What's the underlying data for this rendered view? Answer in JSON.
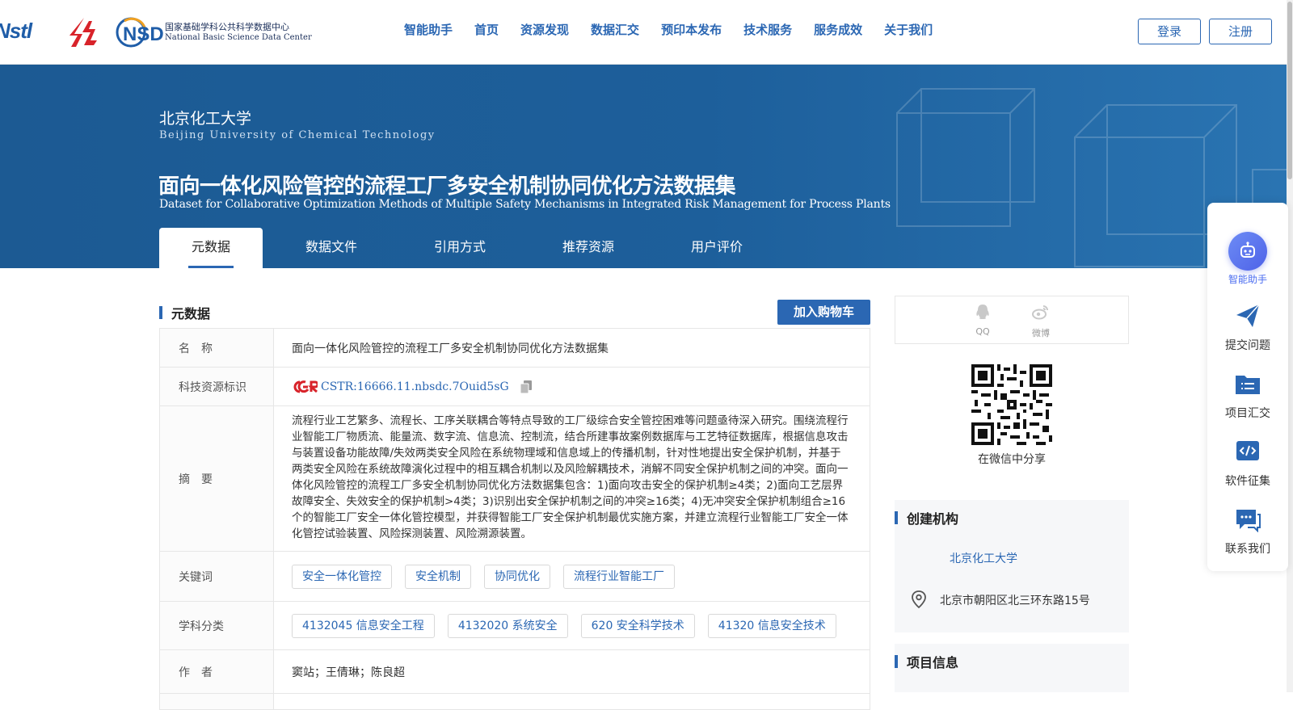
{
  "header": {
    "logo_nstl": "Nstl",
    "logo_nsdc_mark": "NSDC",
    "logo_nsdc_cn": "国家基础学科公共科学数据中心",
    "logo_nsdc_en": "National Basic Science Data Center",
    "nav": [
      "智能助手",
      "首页",
      "资源发现",
      "数据汇交",
      "预印本发布",
      "技术服务",
      "服务成效",
      "关于我们"
    ],
    "login": "登录",
    "register": "注册"
  },
  "banner": {
    "institution_cn": "北京化工大学",
    "institution_en": "Beijing University of Chemical Technology",
    "title_cn": "面向一体化风险管控的流程工厂多安全机制协同优化方法数据集",
    "title_en": "Dataset for Collaborative Optimization Methods of Multiple Safety Mechanisms in Integrated Risk Management for Process Plants",
    "tabs": [
      "元数据",
      "数据文件",
      "引用方式",
      "推荐资源",
      "用户评价"
    ],
    "active_tab": 0
  },
  "metadata": {
    "section_title": "元数据",
    "cart_button": "加入购物车",
    "rows": {
      "name_label": "名　称",
      "name_value": "面向一体化风险管控的流程工厂多安全机制协同优化方法数据集",
      "cstr_label": "科技资源标识",
      "cstr_value": "CSTR:16666.11.nbsdc.7Ouid5sG",
      "abstract_label": "摘　要",
      "abstract_value": "流程行业工艺繁多、流程长、工序关联耦合等特点导致的工厂级综合安全管控困难等问题亟待深入研究。围绕流程行业智能工厂物质流、能量流、数字流、信息流、控制流，结合所建事故案例数据库与工艺特征数据库，根据信息攻击与装置设备功能故障/失效两类安全风险在系统物理域和信息域上的传播机制，针对性地提出安全保护机制，并基于两类安全风险在系统故障演化过程中的相互耦合机制以及风险解耦技术，消解不同安全保护机制之间的冲突。面向一体化风险管控的流程工厂多安全机制协同优化方法数据集包含：1)面向攻击安全的保护机制≥4类；2)面向工艺层界故障安全、失效安全的保护机制>4类；3)识别出安全保护机制之间的冲突≥16类；4)无冲突安全保护机制组合≥16个的智能工厂安全一体化管控模型，并获得智能工厂安全保护机制最优实施方案，并建立流程行业智能工厂安全一体化管控试验装置、风险探测装置、风险溯源装置。",
      "keywords_label": "关键词",
      "keywords": [
        "安全一体化管控",
        "安全机制",
        "协同优化",
        "流程行业智能工厂"
      ],
      "subjects_label": "学科分类",
      "subjects": [
        "4132045 信息安全工程",
        "4132020 系统安全",
        "620 安全科学技术",
        "41320 信息安全技术"
      ],
      "authors_label": "作　者",
      "authors_value": "窦站；王倩琳；陈良超"
    }
  },
  "share": {
    "qq": "QQ",
    "weibo": "微博",
    "wechat_label": "在微信中分享"
  },
  "org_card": {
    "title": "创建机构",
    "name": "北京化工大学",
    "address": "北京市朝阳区北三环东路15号"
  },
  "project_card": {
    "title": "项目信息"
  },
  "float_panel": {
    "items": [
      "智能助手",
      "提交问题",
      "项目汇交",
      "软件征集",
      "联系我们"
    ]
  },
  "colors": {
    "primary": "#2b67b3",
    "banner": "#1d5f9b",
    "ai_accent": "#4e62e8"
  }
}
